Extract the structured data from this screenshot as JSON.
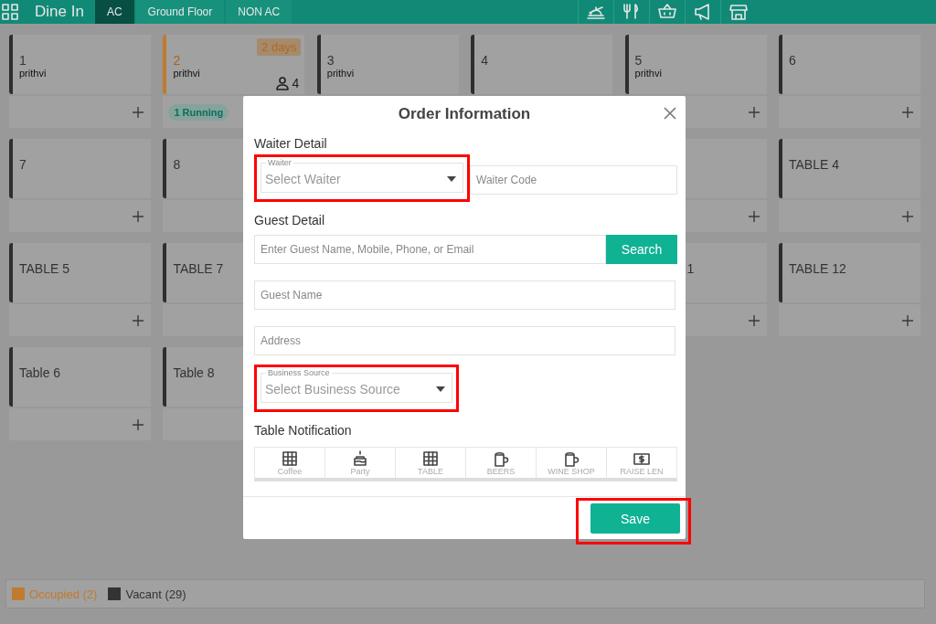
{
  "header": {
    "title": "Dine In",
    "tabs": [
      {
        "label": "AC",
        "selected": true
      },
      {
        "label": "Ground Floor",
        "selected": false
      },
      {
        "label": "NON AC",
        "selected": false
      }
    ],
    "tools": [
      {
        "kind": "cloche"
      },
      {
        "kind": "cutlery"
      },
      {
        "kind": "basket"
      },
      {
        "kind": "megaphone"
      },
      {
        "kind": "store"
      }
    ]
  },
  "tables": [
    {
      "kind": "table",
      "name": "1",
      "user": "prithvi",
      "occupied": false,
      "add": true
    },
    {
      "kind": "table",
      "name": "2",
      "user": "prithvi",
      "occupied": true,
      "duration": "2 days",
      "guests": "4",
      "running": "1 Running",
      "add": false
    },
    {
      "kind": "upper",
      "name": "3",
      "user": "prithvi",
      "occupied": false
    },
    {
      "kind": "upper",
      "name": "4",
      "occupied": false
    },
    {
      "kind": "table",
      "name": "5",
      "user": "prithvi",
      "occupied": false,
      "add": true
    },
    {
      "kind": "table",
      "name": "6",
      "occupied": false,
      "add": true
    },
    {
      "kind": "table",
      "name": "7",
      "occupied": false,
      "add": true
    },
    {
      "kind": "table",
      "name": "8",
      "occupied": false,
      "add": false
    },
    {
      "kind": "hidden"
    },
    {
      "kind": "hidden"
    },
    {
      "kind": "partial",
      "add": true
    },
    {
      "kind": "table",
      "name": "TABLE 4",
      "occupied": false,
      "add": true
    },
    {
      "kind": "table",
      "name": "TABLE 5",
      "occupied": false,
      "add": true
    },
    {
      "kind": "table",
      "name": "TABLE 7",
      "occupied": false,
      "add": false
    },
    {
      "kind": "hidden"
    },
    {
      "kind": "hidden"
    },
    {
      "kind": "partial",
      "name": "1",
      "add": true
    },
    {
      "kind": "table",
      "name": "TABLE 12",
      "occupied": false,
      "add": true
    },
    {
      "kind": "table",
      "name": "Table 6",
      "occupied": false,
      "add": true
    },
    {
      "kind": "table",
      "name": "Table 8",
      "occupied": false,
      "add": false
    }
  ],
  "legend": [
    {
      "label": "Occupied (2)",
      "color": "#c27a2e"
    },
    {
      "label": "Vacant (29)",
      "color": "#333333"
    }
  ],
  "modal": {
    "title": "Order Information",
    "waiter_section": "Waiter Detail",
    "waiter": {
      "label": "Waiter",
      "placeholder": "Select Waiter",
      "highlighted": true
    },
    "waiter_code": {
      "placeholder": "Waiter Code"
    },
    "guest_section": "Guest Detail",
    "guest_search": {
      "placeholder": "Enter Guest Name, Mobile, Phone, or Email",
      "button": "Search"
    },
    "guest_name": {
      "placeholder": "Guest Name"
    },
    "address": {
      "placeholder": "Address"
    },
    "business_source": {
      "label": "Business Source",
      "placeholder": "Select Business Source",
      "highlighted": true
    },
    "notification_section": "Table Notification",
    "notifications": [
      {
        "kind": "grid",
        "label": "Coffee"
      },
      {
        "kind": "cake",
        "label": "Party"
      },
      {
        "kind": "grid",
        "label": "TABLE"
      },
      {
        "kind": "mug",
        "label": "BEERS"
      },
      {
        "kind": "mug",
        "label": "WINE SHOP"
      },
      {
        "kind": "dollar",
        "label": "RAISE LEN"
      }
    ],
    "save": {
      "label": "Save",
      "highlighted": true
    }
  }
}
